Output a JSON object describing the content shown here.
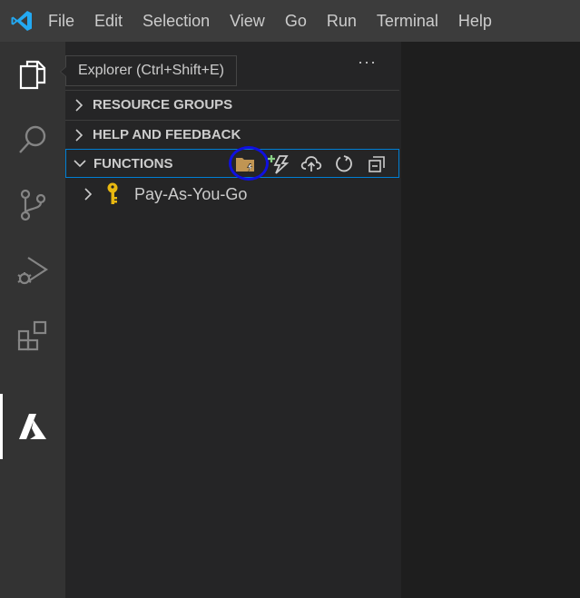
{
  "menubar": {
    "items": [
      "File",
      "Edit",
      "Selection",
      "View",
      "Go",
      "Run",
      "Terminal",
      "Help"
    ]
  },
  "activitybar": {
    "icons": [
      "explorer-icon",
      "search-icon",
      "source-control-icon",
      "run-debug-icon",
      "extensions-icon",
      "azure-icon"
    ],
    "active": "azure-icon"
  },
  "tooltip": {
    "text": "Explorer (Ctrl+Shift+E)"
  },
  "sidebar": {
    "more_actions": "···",
    "sections": [
      {
        "label": "RESOURCE GROUPS",
        "expanded": false
      },
      {
        "label": "HELP AND FEEDBACK",
        "expanded": false
      },
      {
        "label": "FUNCTIONS",
        "expanded": true
      }
    ],
    "function_actions": [
      "create-project-icon",
      "create-function-icon",
      "deploy-icon",
      "refresh-icon",
      "collapse-all-icon"
    ],
    "tree": [
      {
        "label": "Pay-As-You-Go",
        "icon": "key-icon"
      }
    ]
  },
  "colors": {
    "menubar_bg": "#3c3c3c",
    "activitybar_bg": "#333333",
    "sidebar_bg": "#252526",
    "focus_border": "#007fd4",
    "highlight_circle": "#1010e0",
    "key_icon": "#e8b810"
  }
}
